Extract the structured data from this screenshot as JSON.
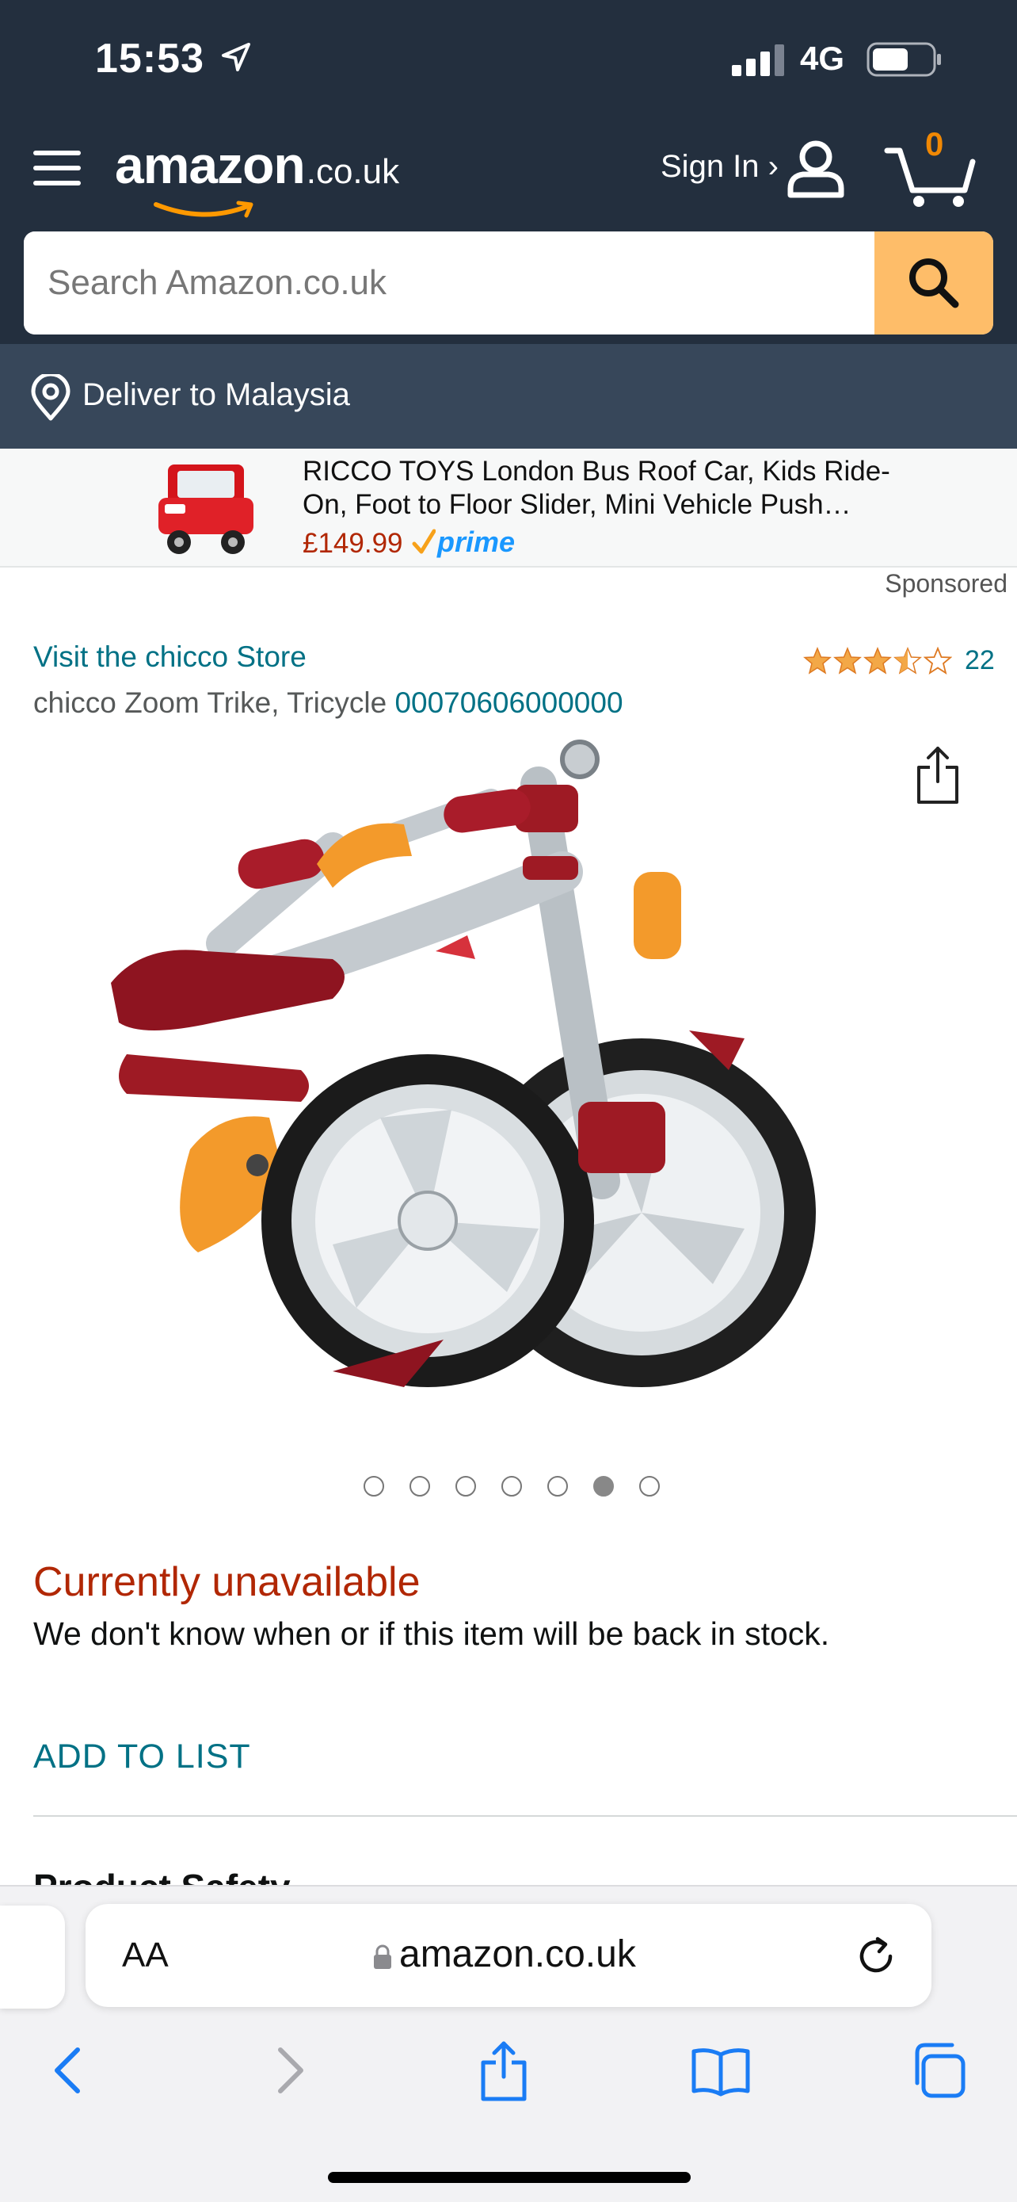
{
  "status": {
    "time": "15:53",
    "network": "4G"
  },
  "header": {
    "logo_word": "amazon",
    "logo_tld": ".co.uk",
    "sign_in": "Sign In ›",
    "cart_count": "0",
    "search_placeholder": "Search Amazon.co.uk",
    "accent_color": "#febd69"
  },
  "deliver": {
    "text": "Deliver to Malaysia"
  },
  "ad": {
    "title": "RICCO TOYS London Bus Roof Car, Kids Ride-On, Foot to Floor Slider, Mini Vehicle Push…",
    "price": "£149.99",
    "prime": "prime",
    "sponsored": "Sponsored"
  },
  "product": {
    "store_link": "Visit the chicco Store",
    "title": "chicco Zoom Trike, Tricycle ",
    "asin": "00070606000000",
    "rating": 3.5,
    "rating_count": "22",
    "image_icon": "tricycle-product-image",
    "image_count": 7,
    "active_image": 6
  },
  "availability": {
    "status": "Currently unavailable",
    "note": "We don't know when or if this item will be back in stock.",
    "status_color": "#b12704"
  },
  "actions": {
    "add_to_list": "ADD TO LIST"
  },
  "next_section": {
    "title": "Product Safety"
  },
  "safari": {
    "text_size": "AA",
    "url": "amazon.co.uk"
  }
}
